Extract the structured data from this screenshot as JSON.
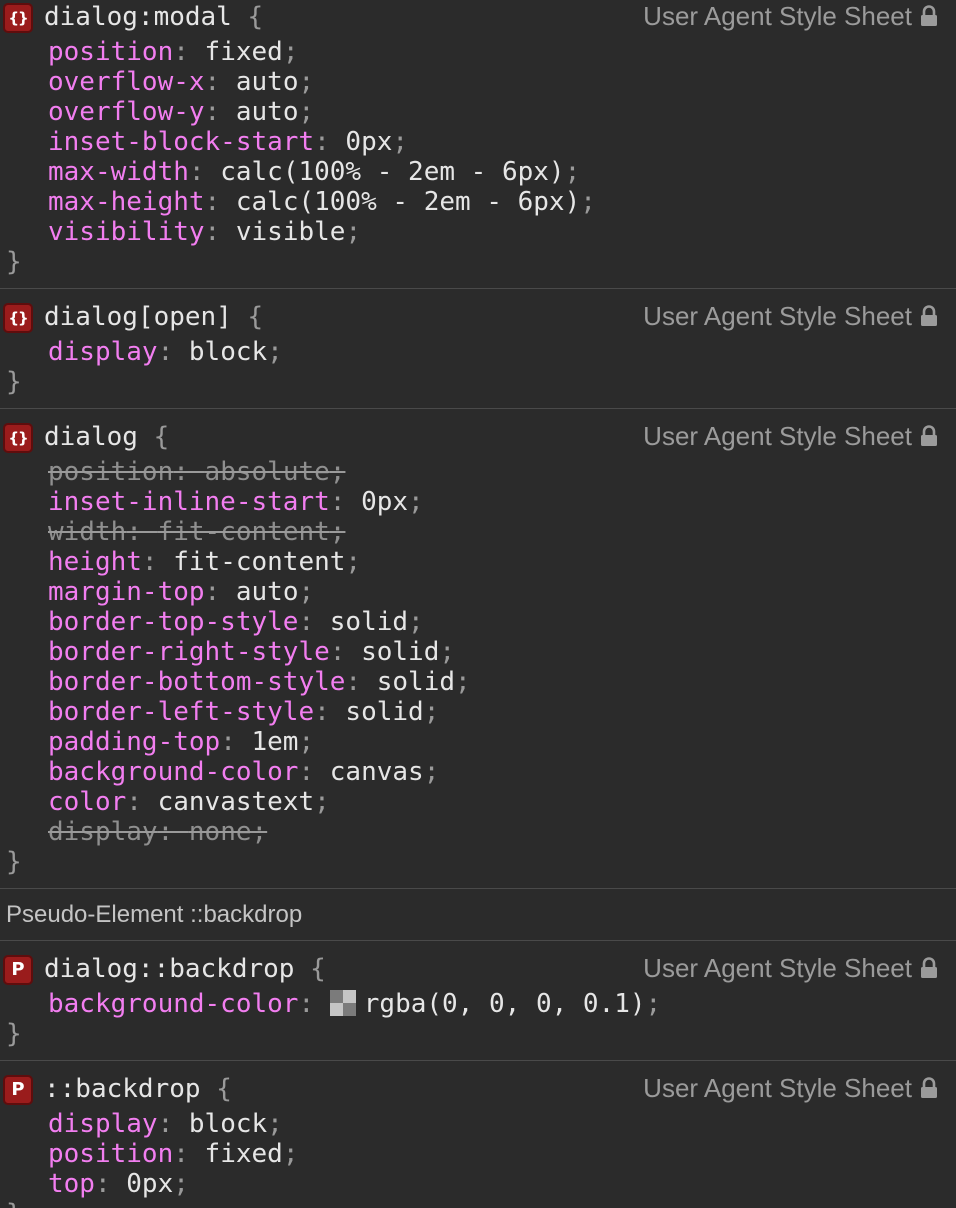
{
  "rules": [
    {
      "badge": "{}",
      "selector": "dialog:modal",
      "source": "User Agent Style Sheet",
      "declarations": [
        {
          "prop": "position",
          "value": "fixed",
          "struck": false
        },
        {
          "prop": "overflow-x",
          "value": "auto",
          "struck": false
        },
        {
          "prop": "overflow-y",
          "value": "auto",
          "struck": false
        },
        {
          "prop": "inset-block-start",
          "value": "0px",
          "struck": false
        },
        {
          "prop": "max-width",
          "value": "calc(100% - 2em - 6px)",
          "struck": false
        },
        {
          "prop": "max-height",
          "value": "calc(100% - 2em - 6px)",
          "struck": false
        },
        {
          "prop": "visibility",
          "value": "visible",
          "struck": false
        }
      ]
    },
    {
      "badge": "{}",
      "selector": "dialog[open]",
      "source": "User Agent Style Sheet",
      "declarations": [
        {
          "prop": "display",
          "value": "block",
          "struck": false
        }
      ]
    },
    {
      "badge": "{}",
      "selector": "dialog",
      "source": "User Agent Style Sheet",
      "declarations": [
        {
          "prop": "position",
          "value": "absolute",
          "struck": true
        },
        {
          "prop": "inset-inline-start",
          "value": "0px",
          "struck": false
        },
        {
          "prop": "width",
          "value": "fit-content",
          "struck": true
        },
        {
          "prop": "height",
          "value": "fit-content",
          "struck": false
        },
        {
          "prop": "margin-top",
          "value": "auto",
          "struck": false
        },
        {
          "prop": "border-top-style",
          "value": "solid",
          "struck": false
        },
        {
          "prop": "border-right-style",
          "value": "solid",
          "struck": false
        },
        {
          "prop": "border-bottom-style",
          "value": "solid",
          "struck": false
        },
        {
          "prop": "border-left-style",
          "value": "solid",
          "struck": false
        },
        {
          "prop": "padding-top",
          "value": "1em",
          "struck": false
        },
        {
          "prop": "background-color",
          "value": "canvas",
          "struck": false
        },
        {
          "prop": "color",
          "value": "canvastext",
          "struck": false
        },
        {
          "prop": "display",
          "value": "none",
          "struck": true
        }
      ]
    },
    {
      "section": "Pseudo-Element ::backdrop"
    },
    {
      "badge": "P",
      "selector": "dialog::backdrop",
      "source": "User Agent Style Sheet",
      "declarations": [
        {
          "prop": "background-color",
          "value": "rgba(0, 0, 0, 0.1)",
          "struck": false,
          "swatch": true
        }
      ]
    },
    {
      "badge": "P",
      "selector": "::backdrop",
      "source": "User Agent Style Sheet",
      "declarations": [
        {
          "prop": "display",
          "value": "block",
          "struck": false
        },
        {
          "prop": "position",
          "value": "fixed",
          "struck": false
        },
        {
          "prop": "top",
          "value": "0px",
          "struck": false
        }
      ]
    }
  ],
  "colors": {
    "background": "#2b2b2b",
    "property": "#f27ef0",
    "value": "#e6e6e6",
    "punctuation": "#9a9a9a",
    "struck": "#8f8f8f",
    "badge": "#9a1c1c",
    "source": "#9b9b9b"
  },
  "icons": {
    "source_lock": "lock-icon",
    "swatch": "color-swatch-icon"
  }
}
